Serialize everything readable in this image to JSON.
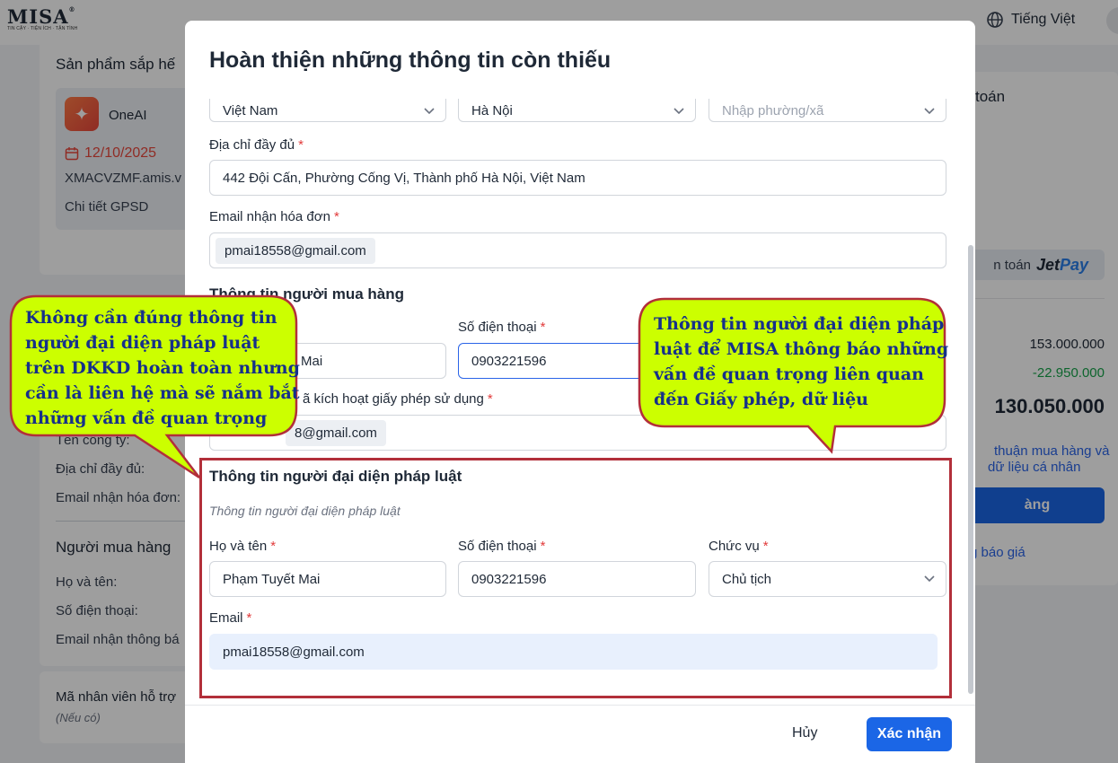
{
  "brand": {
    "logo_text": "MISA",
    "logo_tagline": "TIN CẬY · TIỆN ÍCH · TẬN TÌNH"
  },
  "topbar": {
    "language": "Tiếng Việt"
  },
  "background": {
    "products_title": "Sản phẩm sắp hế",
    "product": {
      "name": "OneAI",
      "date": "12/10/2025",
      "domain": "XMACVZMF.amis.v",
      "detail_link": "Chi tiết GPSD"
    },
    "company_fields": [
      "Tên công ty:",
      "Địa chỉ đầy đủ:",
      "Email nhận hóa đơn:"
    ],
    "buyer_section": "Người mua hàng",
    "buyer_fields": [
      "Họ và tên:",
      "Số điện thoại:",
      "Email nhận thông bá"
    ],
    "support_title": "Mã nhân viên hỗ trợ",
    "support_hint": "(Nếu có)",
    "payment_title": "toán",
    "jetpay_prefix": "n toán",
    "jetpay_logo_a": "Jet",
    "jetpay_logo_b": "Pay",
    "price": "153.000.000",
    "discount": "-22.950.000",
    "total": "130.050.000",
    "agree_text": "thuận mua hàng và",
    "agree_text2": "dữ liệu cá nhân",
    "order_button": "àng",
    "quote_link": "g báo giá"
  },
  "modal": {
    "title": "Hoàn thiện những thông tin còn thiếu",
    "country": "Việt Nam",
    "province": "Hà Nội",
    "ward_placeholder": "Nhập phường/xã",
    "address_label": "Địa chỉ đầy đủ",
    "address_value": "442 Đội Cấn, Phường Cống Vị, Thành phố Hà Nội, Việt Nam",
    "invoice_email_label": "Email nhận hóa đơn",
    "invoice_email": "pmai18558@gmail.com",
    "buyer_section": "Thông tin người mua hàng",
    "buyer_name_partial": "Mai",
    "buyer_phone_label": "Số điện thoại",
    "buyer_phone": "0903221596",
    "activation_email_label": "ã kích hoạt giấy phép sử dụng",
    "activation_email_partial": "8@gmail.com",
    "legal_section": "Thông tin người đại diện pháp luật",
    "legal_hint": "Thông tin người đại diện pháp luật",
    "legal_name_label": "Họ và tên",
    "legal_name": "Phạm Tuyết Mai",
    "legal_phone_label": "Số điện thoại",
    "legal_phone": "0903221596",
    "legal_position_label": "Chức vụ",
    "legal_position": "Chủ tịch",
    "legal_email_label": "Email",
    "legal_email": "pmai18558@gmail.com",
    "cancel_button": "Hủy",
    "confirm_button": "Xác nhận"
  },
  "callouts": {
    "left": [
      "Không cần đúng thông tin",
      "người đại diện pháp luật",
      "trên DKKD hoàn toàn nhưng",
      "cần là liên hệ mà sẽ nắm bắt",
      "những vấn đề quan trọng"
    ],
    "right": [
      "Thông tin người đại diện pháp",
      "luật để MISA thông báo những",
      "vấn đề quan trọng liên quan",
      "đến Giấy phép, dữ liệu"
    ]
  },
  "colors": {
    "primary": "#1b66e6",
    "callout_fill": "#ccff00",
    "callout_border": "#b22f3a",
    "highlight": "#b22f3a"
  }
}
